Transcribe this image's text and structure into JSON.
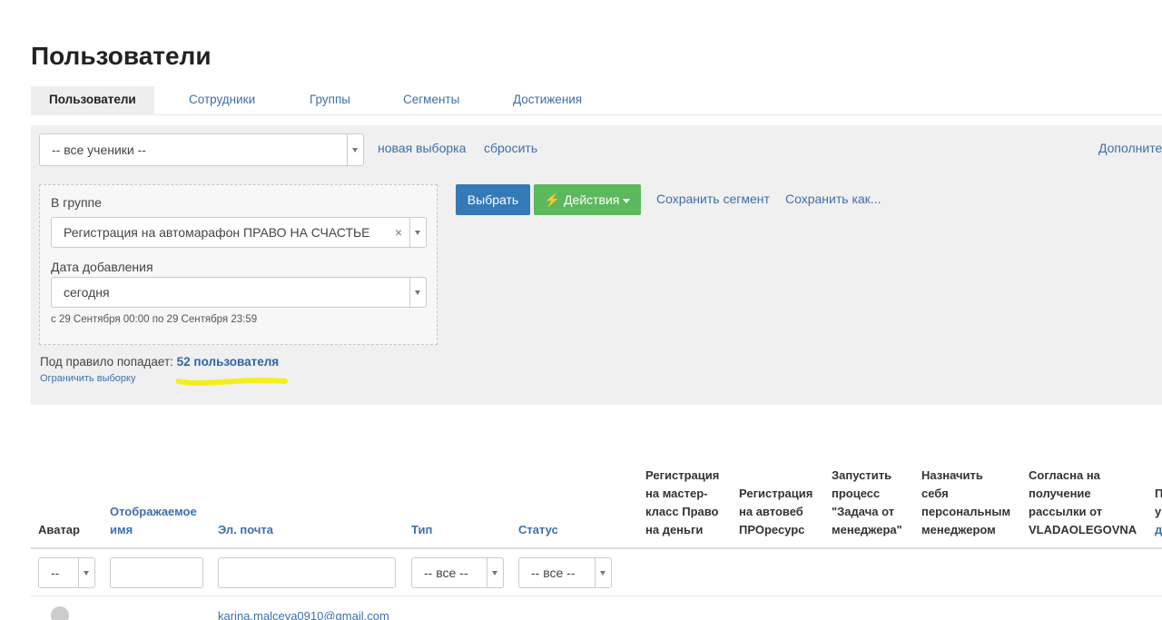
{
  "page": {
    "title": "Пользователи"
  },
  "tabs": [
    {
      "label": "Пользователи",
      "active": true
    },
    {
      "label": "Сотрудники"
    },
    {
      "label": "Группы"
    },
    {
      "label": "Сегменты"
    },
    {
      "label": "Достижения"
    }
  ],
  "filter": {
    "audience_select": "-- все ученики --",
    "new_selection_link": "новая выборка",
    "reset_link": "сбросить",
    "advanced_link": "Дополните"
  },
  "rule": {
    "group_label": "В группе",
    "group_value": "Регистрация на автомарафон ПРАВО НА СЧАСТЬЕ",
    "clear_symbol": "×",
    "date_label": "Дата добавления",
    "date_value": "сегодня",
    "date_range": "с 29 Сентября 00:00 по 29 Сентября 23:59"
  },
  "actions": {
    "select_button": "Выбрать",
    "actions_button": "Действия",
    "save_segment_link": "Сохранить сегмент",
    "save_as_link": "Сохранить как..."
  },
  "summary": {
    "prefix": "Под правило попадает:",
    "count": "52 пользователя",
    "limit_link": "Ограничить выборку",
    "highlight_color": "#f4ee1c"
  },
  "table": {
    "headers": {
      "avatar": "Аватар",
      "display_name_1": "Отображаемое",
      "display_name_2": "имя",
      "email": "Эл. почта",
      "type": "Тип",
      "status": "Статус",
      "col_masterclass": [
        "Регистрация",
        "на мастер-",
        "класс Право",
        "на деньги"
      ],
      "col_webinar": [
        "Регистрация",
        "на автовеб",
        "ПРОресурс"
      ],
      "col_process": [
        "Запустить",
        "процесс",
        "\"Задача от",
        "менеджера\""
      ],
      "col_manager": [
        "Назначить",
        "себя",
        "персональным",
        "менеджером"
      ],
      "col_consent": [
        "Согласна на",
        "получение",
        "рассылки от",
        "VLADAOLEGOVNA"
      ],
      "col_cut": [
        "П",
        "у",
        "д"
      ]
    },
    "filters": {
      "avatar_select": "--",
      "type_select": "-- все --",
      "status_select": "-- все --"
    },
    "rows": [
      {
        "email": "karina.malceva0910@gmail.com"
      }
    ]
  }
}
